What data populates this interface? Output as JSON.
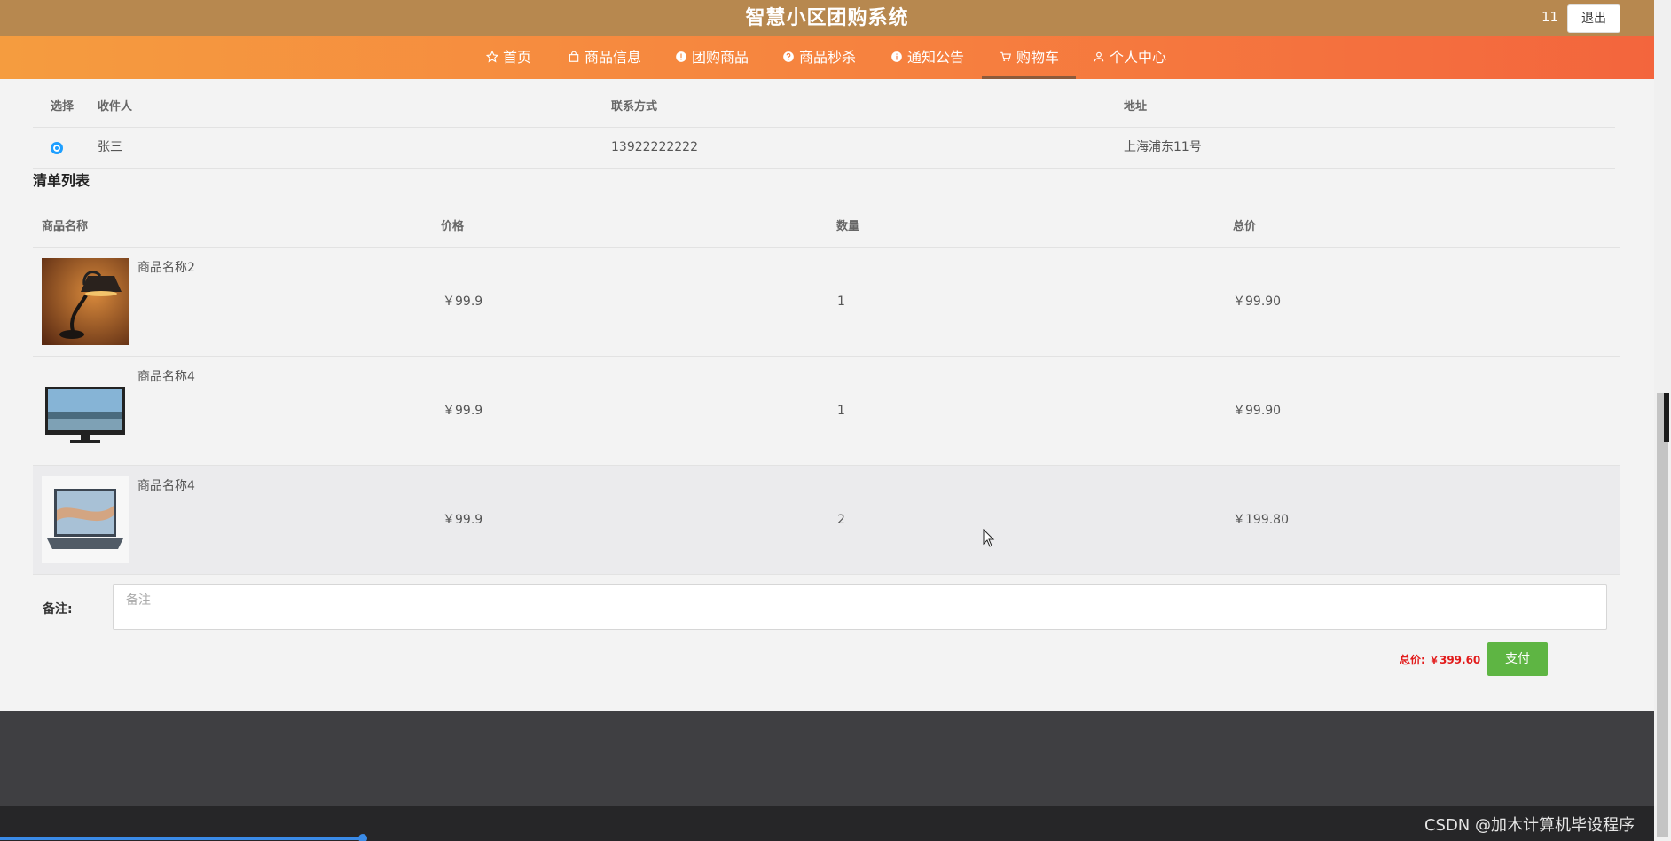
{
  "header": {
    "title": "智慧小区团购系统",
    "user": "11",
    "logout_label": "退出"
  },
  "nav": {
    "items": [
      {
        "label": "首页",
        "icon": "star-icon"
      },
      {
        "label": "商品信息",
        "icon": "bag-icon"
      },
      {
        "label": "团购商品",
        "icon": "alert-circle-icon"
      },
      {
        "label": "商品秒杀",
        "icon": "question-circle-icon"
      },
      {
        "label": "通知公告",
        "icon": "info-circle-icon"
      },
      {
        "label": "购物车",
        "icon": "cart-icon",
        "active": true
      },
      {
        "label": "个人中心",
        "icon": "user-icon"
      }
    ]
  },
  "address_table": {
    "headers": [
      "选择",
      "收件人",
      "联系方式",
      "地址"
    ],
    "rows": [
      {
        "selected": true,
        "name": "张三",
        "phone": "13922222222",
        "address": "上海浦东11号"
      }
    ]
  },
  "order_list": {
    "title": "清单列表",
    "headers": [
      "商品名称",
      "价格",
      "数量",
      "总价"
    ],
    "rows": [
      {
        "name": "商品名称2",
        "price": "￥99.9",
        "qty": "1",
        "total": "￥99.90",
        "image": "desk-lamp-image"
      },
      {
        "name": "商品名称4",
        "price": "￥99.9",
        "qty": "1",
        "total": "￥99.90",
        "image": "monitor-image"
      },
      {
        "name": "商品名称4",
        "price": "￥99.9",
        "qty": "2",
        "total": "￥199.80",
        "image": "laptop-image"
      }
    ]
  },
  "note": {
    "label": "备注:",
    "placeholder": "备注"
  },
  "summary": {
    "total_label": "总价: ￥399.60",
    "pay_label": "支付"
  },
  "watermark": "CSDN @加木计算机毕设程序",
  "colors": {
    "topbar": "#b7884f",
    "nav_start": "#f59c3f",
    "nav_end": "#f3653d",
    "pay": "#5eb543",
    "total": "#e21b1b",
    "footer": "#3f3f42"
  }
}
